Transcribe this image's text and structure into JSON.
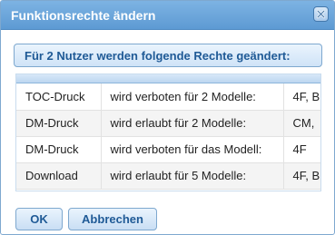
{
  "dialog": {
    "title": "Funktionsrechte ändern",
    "close_icon": "close-icon"
  },
  "banner": {
    "text": "Für 2 Nutzer werden folgende Rechte geändert:"
  },
  "table": {
    "rows": [
      {
        "right": "TOC-Druck",
        "action": "wird verboten für 2 Modelle:",
        "models": "4F, B"
      },
      {
        "right": "DM-Druck",
        "action": "wird erlaubt für 2 Modelle:",
        "models": "CM,"
      },
      {
        "right": "DM-Druck",
        "action": "wird verboten für das Modell:",
        "models": "4F"
      },
      {
        "right": "Download",
        "action": "wird erlaubt für 5 Modelle:",
        "models": "4F, B"
      }
    ]
  },
  "buttons": {
    "ok_label": "OK",
    "cancel_label": "Abbrechen"
  },
  "colors": {
    "titlebar": "#6aa6dc",
    "accent_text": "#1f5a96",
    "border": "#7ea8cf"
  }
}
